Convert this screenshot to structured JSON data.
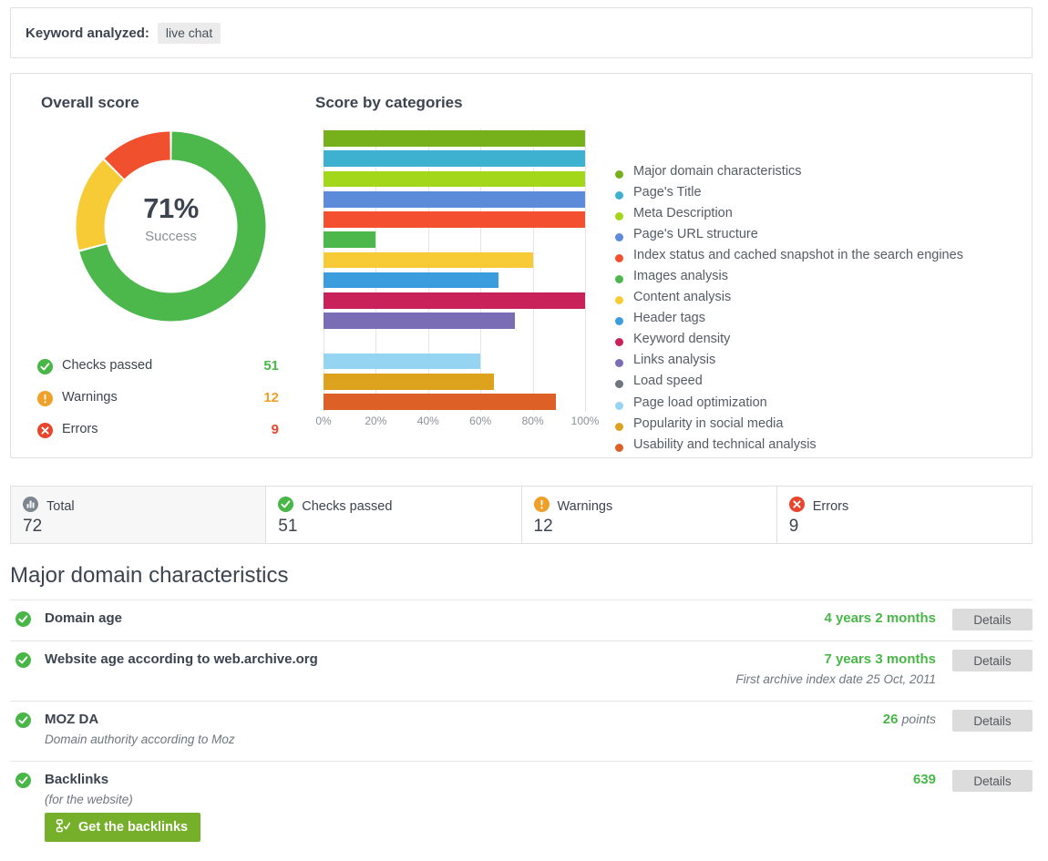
{
  "keyword_bar": {
    "label": "Keyword analyzed:",
    "keyword": "live chat"
  },
  "score_panel": {
    "overall_title": "Overall score",
    "categories_title": "Score by categories",
    "donut": {
      "percent_text": "71%",
      "status_text": "Success",
      "segments": [
        {
          "name": "Checks passed",
          "value": 51,
          "color": "#4cb84c"
        },
        {
          "name": "Warnings",
          "value": 12,
          "color": "#f7cb36"
        },
        {
          "name": "Errors",
          "value": 9,
          "color": "#f1502f"
        }
      ]
    },
    "stats": [
      {
        "icon": "check-circle-icon",
        "label": "Checks passed",
        "value": "51",
        "color": "#49b748"
      },
      {
        "icon": "warning-circle-icon",
        "label": "Warnings",
        "value": "12",
        "color": "#f0a028"
      },
      {
        "icon": "error-circle-icon",
        "label": "Errors",
        "value": "9",
        "color": "#e8462c"
      }
    ]
  },
  "chart_data": {
    "type": "bar",
    "orientation": "horizontal",
    "title": "Score by categories",
    "xlabel": "",
    "ylabel": "",
    "xlim": [
      0,
      100
    ],
    "grid": true,
    "legend_position": "right",
    "tick_labels": [
      "0%",
      "20%",
      "40%",
      "60%",
      "80%",
      "100%"
    ],
    "ticks": [
      0,
      20,
      40,
      60,
      80,
      100
    ],
    "categories": [
      "Major domain characteristics",
      "Page's Title",
      "Meta Description",
      "Page's URL structure",
      "Index status and cached snapshot in the search engines",
      "Images analysis",
      "Content analysis",
      "Header tags",
      "Keyword density",
      "Links analysis",
      "Load speed",
      "Page load optimization",
      "Popularity in social media",
      "Usability and technical analysis"
    ],
    "values": [
      100,
      100,
      100,
      100,
      100,
      20,
      80,
      67,
      100,
      73,
      0,
      60,
      65,
      89
    ],
    "colors": [
      "#76b01a",
      "#3eb1d0",
      "#a3d71a",
      "#5b8bd9",
      "#f4502f",
      "#4cb84c",
      "#f7cb36",
      "#3b9ddd",
      "#c9225a",
      "#7a6cb5",
      "#6e767e",
      "#95d5f2",
      "#dda31f",
      "#dd6127"
    ]
  },
  "summary_cards": [
    {
      "icon": "chart-bar-circle-icon",
      "label": "Total",
      "value": "72",
      "color": "#7d858e"
    },
    {
      "icon": "check-circle-icon",
      "label": "Checks passed",
      "value": "51",
      "color": "#49b748"
    },
    {
      "icon": "warning-circle-icon",
      "label": "Warnings",
      "value": "12",
      "color": "#f0a028"
    },
    {
      "icon": "error-circle-icon",
      "label": "Errors",
      "value": "9",
      "color": "#e8462c"
    }
  ],
  "section": {
    "title": "Major domain characteristics"
  },
  "checks": [
    {
      "status": "check-circle-icon",
      "name": "Domain age",
      "sub": "",
      "value": "4 years 2 months",
      "unit": "",
      "note": "",
      "details_label": "Details"
    },
    {
      "status": "check-circle-icon",
      "name": "Website age according to web.archive.org",
      "sub": "",
      "value": "7 years 3 months",
      "unit": "",
      "note": "First archive index date 25 Oct, 2011",
      "details_label": "Details"
    },
    {
      "status": "check-circle-icon",
      "name": "MOZ DA",
      "sub": "Domain authority according to Moz",
      "value": "26",
      "unit": "points",
      "note": "",
      "details_label": "Details"
    },
    {
      "status": "check-circle-icon",
      "name": "Backlinks",
      "sub": "(for the website)",
      "value": "639",
      "unit": "",
      "note": "",
      "details_label": "Details",
      "cta_label": "Get the backlinks",
      "cta_icon": "link-check-icon"
    }
  ]
}
